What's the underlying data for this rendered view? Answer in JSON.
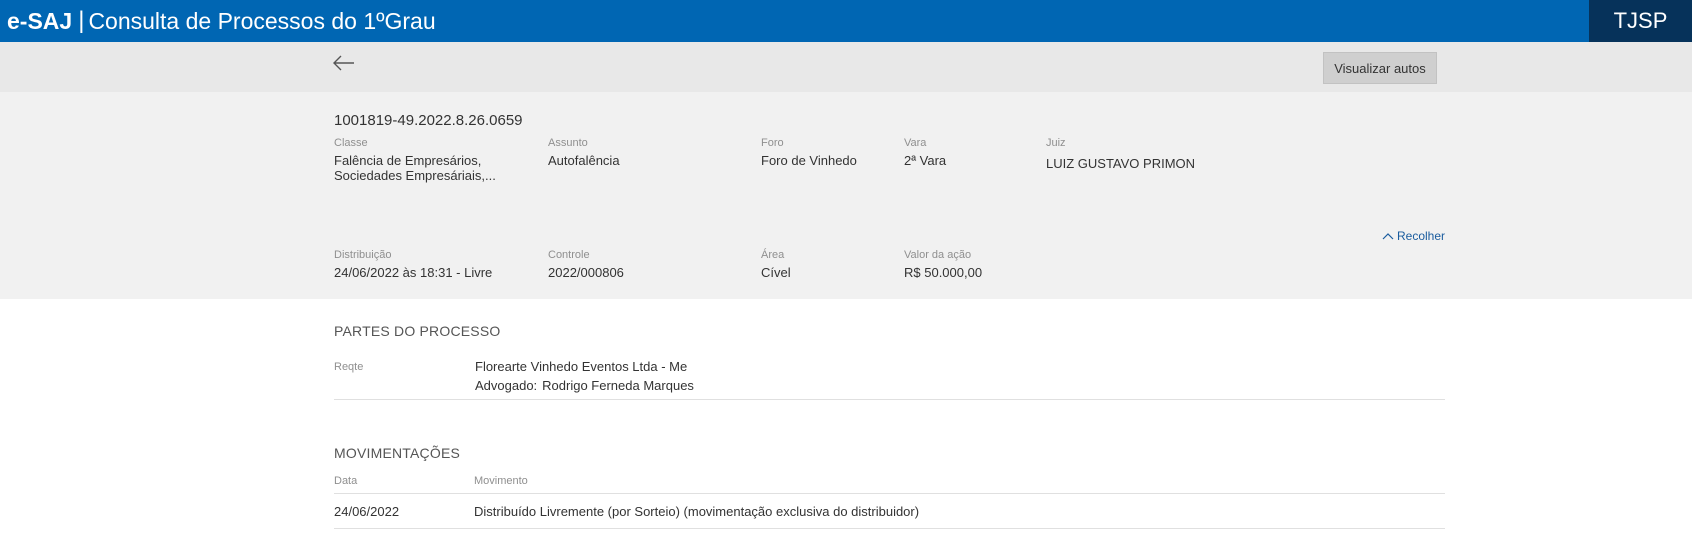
{
  "header": {
    "logo": "e-SAJ",
    "separator": "|",
    "title": "Consulta de Processos do 1ºGrau",
    "court": "TJSP"
  },
  "toolbar": {
    "back_icon": "arrow-left-icon",
    "view_button": "Visualizar autos"
  },
  "process": {
    "number": "1001819-49.2022.8.26.0659",
    "fields_top": [
      {
        "label": "Classe",
        "value_lines": [
          "Falência de Empresários,",
          "Sociedades Empresáriais,..."
        ]
      },
      {
        "label": "Assunto",
        "value": "Autofalência"
      },
      {
        "label": "Foro",
        "value": "Foro de Vinhedo"
      },
      {
        "label": "Vara",
        "value": "2ª Vara"
      },
      {
        "label": "Juiz",
        "value": "LUIZ GUSTAVO PRIMON"
      }
    ],
    "collapse_label": "Recolher",
    "fields_bottom": [
      {
        "label": "Distribuição",
        "value": "24/06/2022 às 18:31 - Livre"
      },
      {
        "label": "Controle",
        "value": "2022/000806"
      },
      {
        "label": "Área",
        "value": "Cível"
      },
      {
        "label": "Valor da ação",
        "value": "R$ 50.000,00"
      }
    ]
  },
  "partes": {
    "title": "PARTES DO PROCESSO",
    "items": [
      {
        "type": "Reqte",
        "name": "Florearte Vinhedo Eventos Ltda - Me",
        "lawyer_label": "Advogado:",
        "lawyer": "Rodrigo Ferneda Marques"
      }
    ]
  },
  "movimentacoes": {
    "title": "MOVIMENTAÇÕES",
    "columns": [
      "Data",
      "Movimento"
    ],
    "rows": [
      {
        "date": "24/06/2022",
        "text": "Distribuído Livremente (por Sorteio) (movimentação exclusiva do distribuidor)"
      }
    ]
  },
  "colors": {
    "header_bg": "#0066b3",
    "court_bg": "#06325a",
    "toolbar_bg": "#e8e8e8",
    "summary_bg": "#f1f1f1",
    "link": "#1a5c9e"
  }
}
